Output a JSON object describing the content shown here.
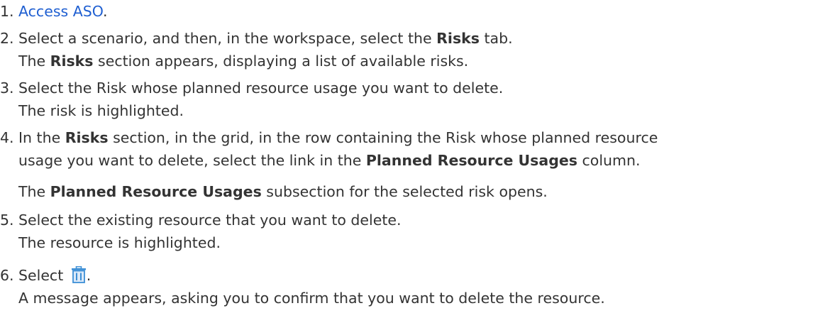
{
  "steps": [
    {
      "number": "1.",
      "link_text": "Access ASO",
      "after_link": "."
    },
    {
      "number": "2.",
      "line1_a": "Select a scenario, and then, in the workspace, select the ",
      "line1_b": "Risks",
      "line1_c": " tab.",
      "line2_a": "The ",
      "line2_b": "Risks",
      "line2_c": " section appears, displaying a list of available risks."
    },
    {
      "number": "3.",
      "line1": "Select the Risk whose planned resource usage you want to delete.",
      "line2": "The risk is highlighted."
    },
    {
      "number": "4.",
      "line1_a": "In the ",
      "line1_b": "Risks",
      "line1_c": " section, in the grid, in the row containing the Risk whose planned resource",
      "line2_a": "usage you want to delete, select the link in the ",
      "line2_b": "Planned Resource Usages",
      "line2_c": " column.",
      "line3_a": "The ",
      "line3_b": "Planned Resource Usages",
      "line3_c": " subsection for the selected risk opens."
    },
    {
      "number": "5.",
      "line1": "Select the existing resource that you want to delete.",
      "line2": "The resource is highlighted."
    },
    {
      "number": "6.",
      "line1_a": "Select ",
      "icon": "trash-icon",
      "line1_c": ".",
      "line2": "A message appears, asking you to confirm that you want to delete the resource."
    }
  ],
  "colors": {
    "text": "#333333",
    "link": "#1f5fd1",
    "icon": "#3d8fd6"
  }
}
